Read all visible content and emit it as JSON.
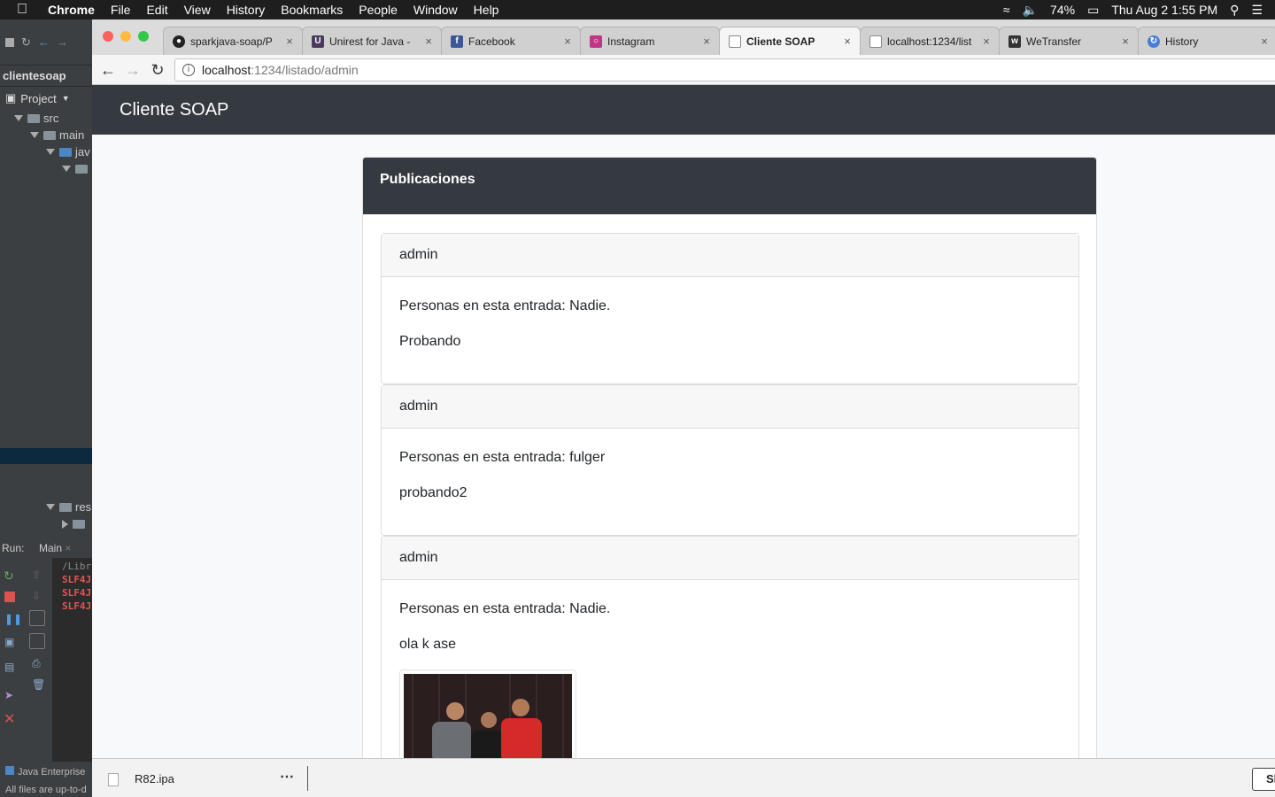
{
  "menubar": {
    "app": "Chrome",
    "items": [
      "File",
      "Edit",
      "View",
      "History",
      "Bookmarks",
      "People",
      "Window",
      "Help"
    ],
    "battery": "74%",
    "datetime": "Thu Aug 2  1:55 PM"
  },
  "ide": {
    "breadcrumb": "clientesoap",
    "project_label": "Project",
    "tree": [
      "src",
      "main",
      "jav",
      "res"
    ],
    "run_label": "Run:",
    "run_tab": "Main",
    "console_lines": [
      "/Libr",
      "SLF4J",
      "SLF4J",
      "SLF4J"
    ],
    "status_lines": [
      "Java Enterprise",
      "All files are up-to-d"
    ]
  },
  "browser": {
    "tabs": [
      {
        "title": "sparkjava-soap/P",
        "icon": "github-icon",
        "color": "#222222"
      },
      {
        "title": "Unirest for Java -",
        "icon": "unirest-icon",
        "color": "#4a3b5e"
      },
      {
        "title": "Facebook",
        "icon": "facebook-icon",
        "color": "#3b5998"
      },
      {
        "title": "Instagram",
        "icon": "instagram-icon",
        "color": "#c13584"
      },
      {
        "title": "Cliente SOAP",
        "icon": "page-icon",
        "color": "#888888"
      },
      {
        "title": "localhost:1234/list",
        "icon": "page-icon",
        "color": "#888888"
      },
      {
        "title": "WeTransfer",
        "icon": "wetransfer-icon",
        "color": "#333333"
      },
      {
        "title": "History",
        "icon": "history-icon",
        "color": "#4a7fd6"
      }
    ],
    "url_host": "localhost",
    "url_rest": ":1234/listado/admin"
  },
  "page": {
    "brand": "Cliente SOAP",
    "card_title": "Publicaciones",
    "posts": [
      {
        "author": "admin",
        "people": "Personas en esta entrada: Nadie.",
        "text": "Probando"
      },
      {
        "author": "admin",
        "people": "Personas en esta entrada: fulger",
        "text": "probando2"
      },
      {
        "author": "admin",
        "people": "Personas en esta entrada: Nadie.",
        "text": "ola k ase"
      }
    ]
  },
  "downloads": {
    "file": "R82.ipa",
    "more": "⋯",
    "show_all": "Sh"
  },
  "colors": {
    "navbar": "#343a40",
    "close_red": "#fc605c",
    "minimize_yellow": "#fdbc40",
    "zoom_green": "#34c84a"
  }
}
